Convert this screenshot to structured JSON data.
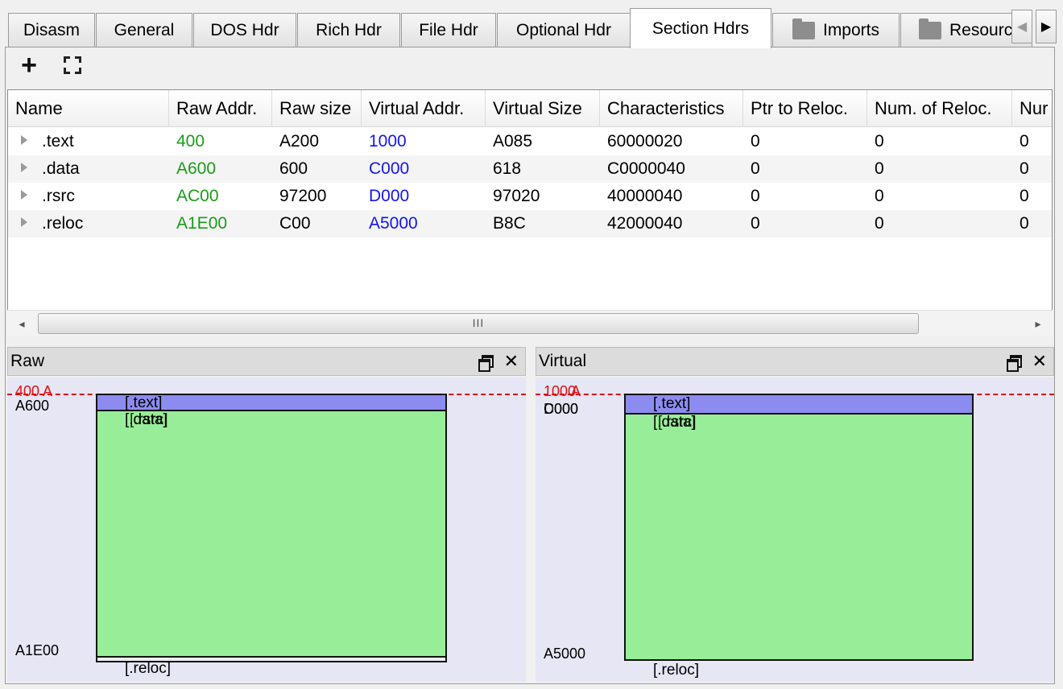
{
  "tabs": [
    {
      "label": "Disasm"
    },
    {
      "label": "General"
    },
    {
      "label": "DOS Hdr"
    },
    {
      "label": "Rich Hdr"
    },
    {
      "label": "File Hdr"
    },
    {
      "label": "Optional Hdr"
    },
    {
      "label": "Section Hdrs",
      "active": true
    },
    {
      "label": "Imports",
      "icon": "folder-icon"
    },
    {
      "label": "Resourc",
      "icon": "folder-icon"
    }
  ],
  "tab_scroll": {
    "left": "◀",
    "right": "▶"
  },
  "toolbar": {
    "add_label": "+",
    "add_icon": "plus-icon",
    "expand_icon": "expand-icon"
  },
  "table": {
    "columns": [
      "Name",
      "Raw Addr.",
      "Raw size",
      "Virtual Addr.",
      "Virtual Size",
      "Characteristics",
      "Ptr to Reloc.",
      "Num. of Reloc.",
      "Nur"
    ],
    "rows": [
      {
        "name": ".text",
        "raw_addr": "400",
        "raw_size": "A200",
        "virt_addr": "1000",
        "virt_size": "A085",
        "characteristics": "60000020",
        "ptr_reloc": "0",
        "num_reloc": "0",
        "num_lines": "0"
      },
      {
        "name": ".data",
        "raw_addr": "A600",
        "raw_size": "600",
        "virt_addr": "C000",
        "virt_size": "618",
        "characteristics": "C0000040",
        "ptr_reloc": "0",
        "num_reloc": "0",
        "num_lines": "0"
      },
      {
        "name": ".rsrc",
        "raw_addr": "AC00",
        "raw_size": "97200",
        "virt_addr": "D000",
        "virt_size": "97020",
        "characteristics": "40000040",
        "ptr_reloc": "0",
        "num_reloc": "0",
        "num_lines": "0"
      },
      {
        "name": ".reloc",
        "raw_addr": "A1E00",
        "raw_size": "C00",
        "virt_addr": "A5000",
        "virt_size": "B8C",
        "characteristics": "42000040",
        "ptr_reloc": "0",
        "num_reloc": "0",
        "num_lines": "0"
      }
    ],
    "hscroll_grip": "III"
  },
  "colors": {
    "raw_addr": "#1a9c1a",
    "virt_addr": "#1414f0",
    "text_section": "#8c8cf0",
    "other_section": "#98ee98",
    "marker": "#e01010",
    "panel_bg": "#e6e6f5"
  },
  "raw_panel": {
    "title": "Raw",
    "top_addr_red": "400",
    "top_addr_overlap": "A",
    "addr_a600": "A600",
    "bottom_addr": "A1E00",
    "labels": {
      "text": "[.text]",
      "data": "[.data]",
      "rsrc": "[.rsrc]",
      "reloc": "[.reloc]"
    }
  },
  "virtual_panel": {
    "title": "Virtual",
    "top_addr_red": "1000",
    "top_addr_overlap": "A",
    "addr_c000": "C000",
    "addr_d000": "D000",
    "bottom_addr": "A5000",
    "labels": {
      "text": "[.text]",
      "data": "[.data]",
      "rsrc": "[.rsrc]",
      "reloc": "[.reloc]"
    }
  },
  "dock_buttons": {
    "float_icon": "float-window-icon",
    "close_label": "✕",
    "close_icon": "close-icon"
  }
}
